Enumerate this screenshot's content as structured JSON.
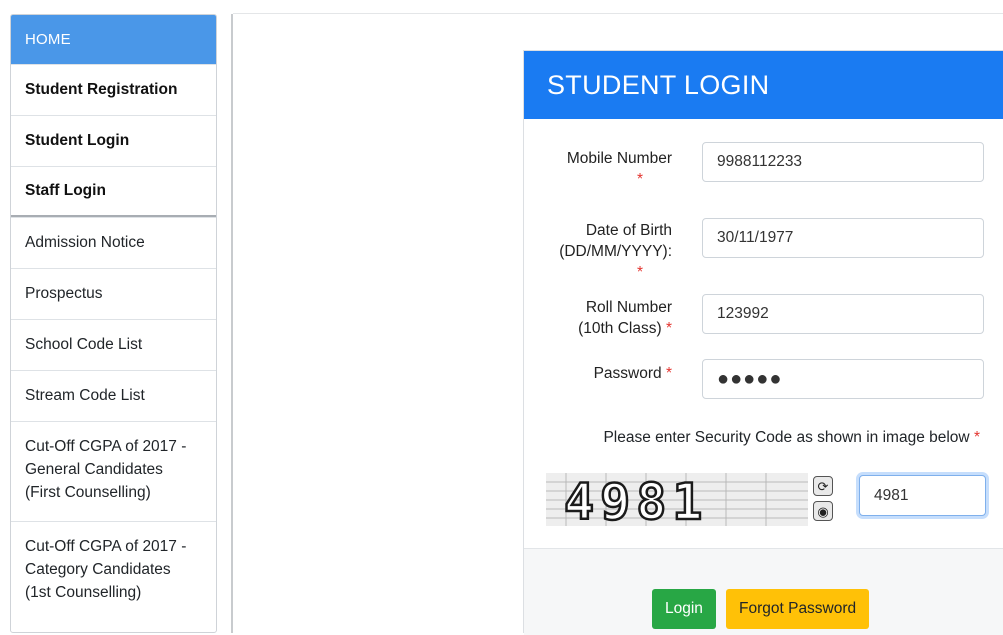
{
  "sidebar": {
    "items": [
      {
        "label": "HOME"
      },
      {
        "label": "Student Registration"
      },
      {
        "label": "Student Login"
      },
      {
        "label": "Staff Login"
      },
      {
        "label": "Admission Notice"
      },
      {
        "label": "Prospectus"
      },
      {
        "label": "School Code List"
      },
      {
        "label": "Stream Code List"
      },
      {
        "lines": [
          "Cut-Off CGPA of 2017 -",
          "General Candidates",
          "(First Counselling)"
        ]
      },
      {
        "lines": [
          "Cut-Off CGPA of 2017 -",
          "Category Candidates",
          "(1st Counselling)"
        ]
      }
    ]
  },
  "login": {
    "title": "STUDENT LOGIN",
    "required_mark": "*",
    "mobile": {
      "label": "Mobile Number",
      "value": "9988112233"
    },
    "dob": {
      "label_line1": "Date of Birth",
      "label_line2": "(DD/MM/YYYY):",
      "value": "30/11/1977"
    },
    "roll": {
      "label_line1": "Roll Number",
      "label_line2": "(10th Class)",
      "value": "123992"
    },
    "password": {
      "label": "Password",
      "value": "●●●●●"
    },
    "security": {
      "text": "Please enter Security Code as shown in image below",
      "captcha_text": "4981",
      "value": "4981"
    },
    "buttons": {
      "login": "Login",
      "forgot": "Forgot Password"
    }
  },
  "colors": {
    "primary": "#1a7bf2",
    "home": "#4a97e8",
    "success": "#28a745",
    "warning": "#ffc107",
    "required": "#e3342f"
  }
}
